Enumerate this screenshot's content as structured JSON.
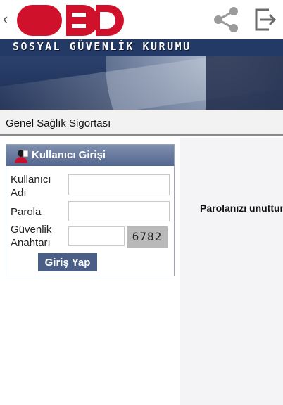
{
  "header": {
    "brand_text": "SOSYAL GÜVENLİK KURUMU",
    "back_icon": "chevron-left-icon",
    "share_icon": "share-icon",
    "exit_icon": "exit-icon",
    "logo_color": "#d0112b"
  },
  "breadcrumb": {
    "label": "Genel Sağlık Sigortası"
  },
  "login": {
    "title": "Kullanıcı Girişi",
    "username_label_line1": "Kullanıcı",
    "username_label_line2": "Adı",
    "username_value": "",
    "password_label": "Parola",
    "password_value": "",
    "security_label_line1": "Güvenlik",
    "security_label_line2": "Anahtarı",
    "security_value": "",
    "captcha_code": "6782",
    "submit_label": "Giriş Yap"
  },
  "right_panel": {
    "message": "Parolanızı unuttunuz mu?"
  },
  "colors": {
    "panel_header": "#53668e",
    "button": "#4b5f86",
    "right_panel_bg": "#f4f4f6"
  }
}
